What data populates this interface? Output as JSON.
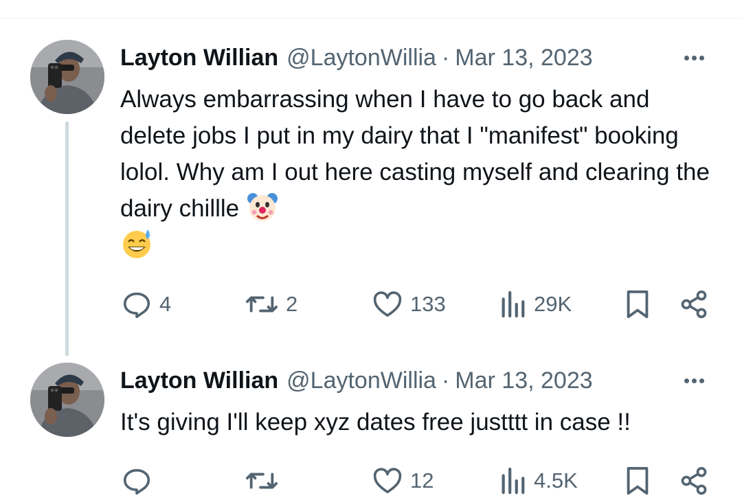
{
  "tweets": [
    {
      "author": {
        "name": "Layton Willian",
        "handle": "@LaytonWillia"
      },
      "separator": "·",
      "date": "Mar 13, 2023",
      "text": "Always embarrassing when I have to go back and delete jobs I put in my dairy that I \"manifest\" booking lolol. Why am I out here casting myself and clearing the dairy chillle",
      "emojis": [
        "clown-face-emoji",
        "grinning-sweat-emoji"
      ],
      "stats": {
        "replies": "4",
        "retweets": "2",
        "likes": "133",
        "views": "29K"
      }
    },
    {
      "author": {
        "name": "Layton Willian",
        "handle": "@LaytonWillia"
      },
      "separator": "·",
      "date": "Mar 13, 2023",
      "text": "It's giving I'll keep xyz dates free justttt in case !!",
      "stats": {
        "replies": "",
        "retweets": "",
        "likes": "12",
        "views": "4.5K"
      }
    }
  ],
  "icons": {
    "reply": "reply-icon",
    "retweet": "retweet-icon",
    "like": "heart-icon",
    "views": "views-icon",
    "bookmark": "bookmark-icon",
    "share": "share-icon",
    "more": "more-icon"
  },
  "colors": {
    "text": "#0f1419",
    "muted": "#536471",
    "thread_line": "#cfd9de"
  }
}
